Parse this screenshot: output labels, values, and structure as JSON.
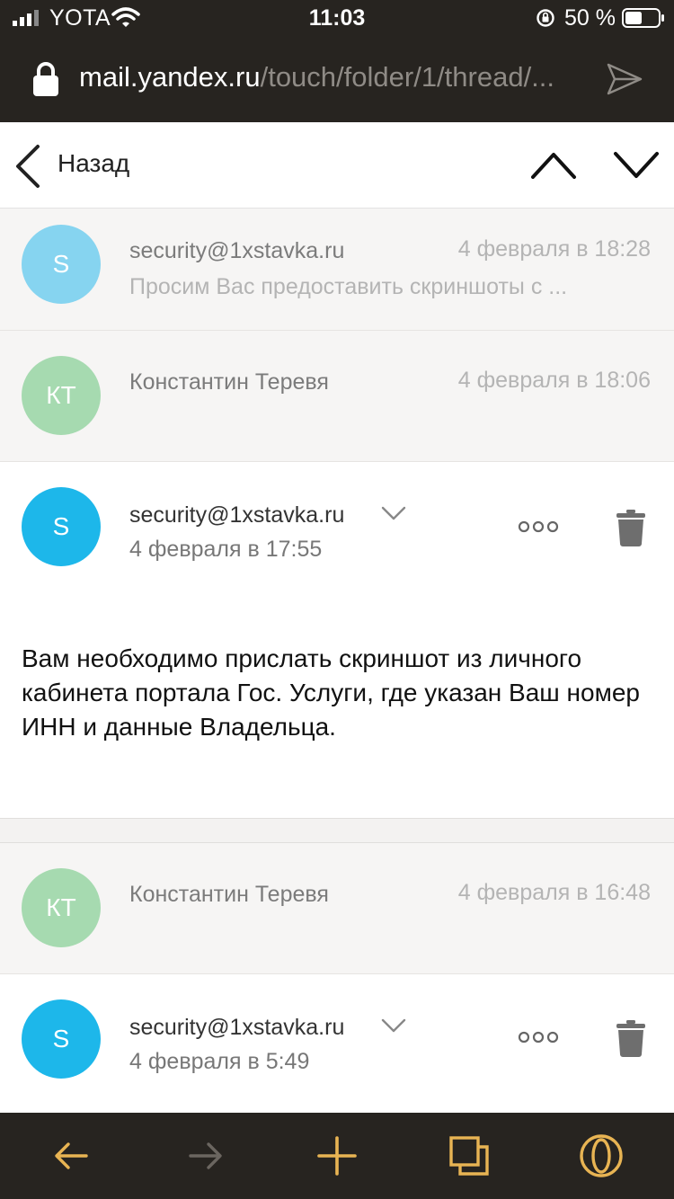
{
  "status_bar": {
    "carrier": "YOTA",
    "time": "11:03",
    "battery": "50 %"
  },
  "browser": {
    "url_host": "mail.yandex.ru",
    "url_path": "/touch/folder/1/thread/..."
  },
  "nav": {
    "back_label": "Назад"
  },
  "messages": [
    {
      "avatar": "S",
      "avatar_color": "#86d4f0",
      "sender": "security@1xstavka.ru",
      "date": "4 февраля в 18:28",
      "snippet": "Просим Вас предоставить скриншоты с ..."
    },
    {
      "avatar": "КТ",
      "avatar_color": "#a6dab0",
      "sender": "Константин Теревя",
      "date": "4 февраля в 18:06"
    },
    {
      "avatar": "S",
      "avatar_color": "#1db7ea",
      "sender": "security@1xstavka.ru",
      "date": "4 февраля в 17:55",
      "body": "Вам необходимо прислать скриншот из личного кабинета портала Гос. Услуги, где указан Ваш номер ИНН и данные Владельца."
    },
    {
      "avatar": "КТ",
      "avatar_color": "#a6dab0",
      "sender": "Константин Теревя",
      "date": "4 февраля в 16:48"
    },
    {
      "avatar": "S",
      "avatar_color": "#1db7ea",
      "sender": "security@1xstavka.ru",
      "date": "4 февраля в 5:49"
    }
  ],
  "colors": {
    "chrome_bg": "#272420",
    "toolbar_accent": "#e8b453",
    "toolbar_disabled": "#6b6660"
  }
}
